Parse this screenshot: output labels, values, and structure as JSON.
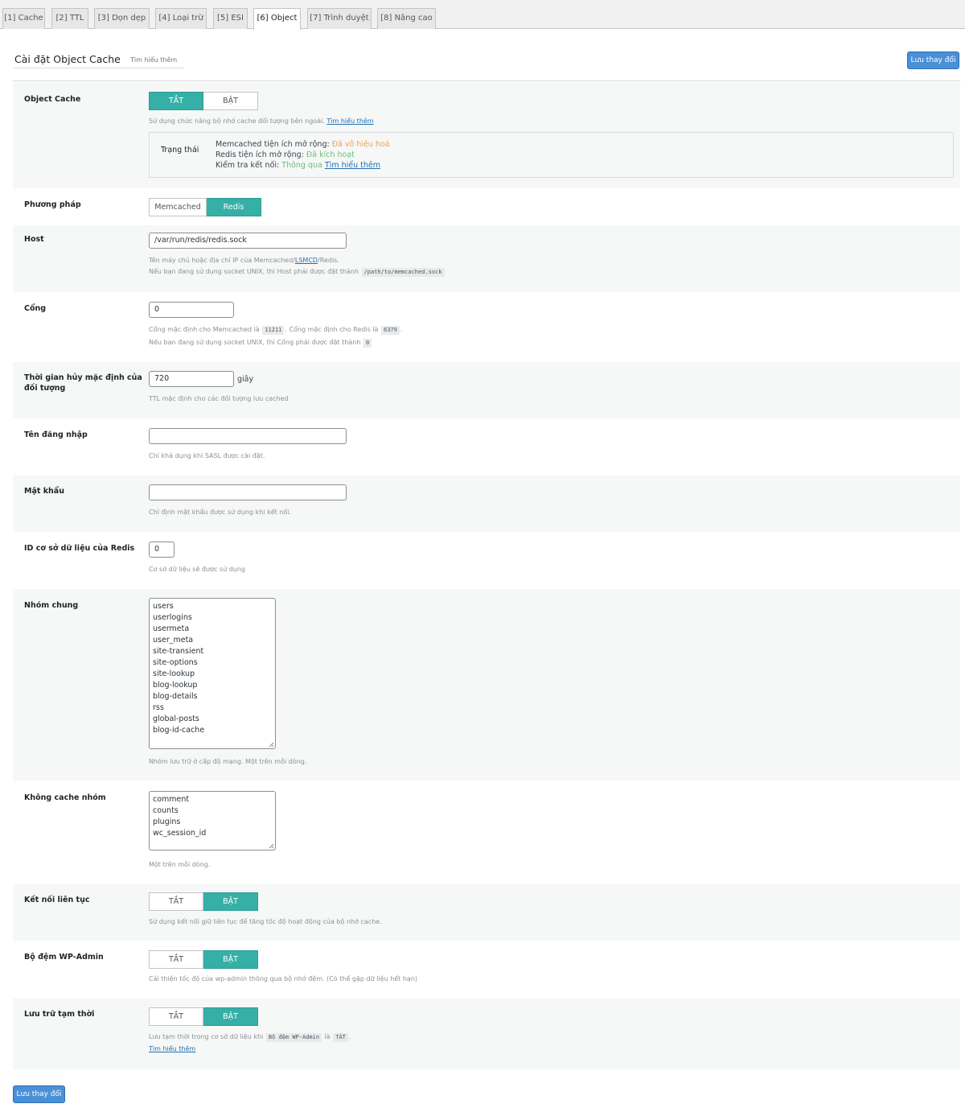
{
  "tabs": [
    "[1] Cache",
    "[2] TTL",
    "[3] Dọn dẹp",
    "[4] Loại trừ",
    "[5] ESI",
    "[6] Object",
    "[7] Trình duyệt",
    "[8] Nâng cao"
  ],
  "active_tab_index": 5,
  "header": {
    "title": "Cài đặt Object Cache",
    "learn_more": "Tìm hiểu thêm"
  },
  "save_label": "Lưu thay đổi",
  "colors": {
    "toggle_on": "#36b0a7",
    "primary_button": "#4a90d9",
    "link": "#2271b1",
    "warning": "#f0a14a",
    "success": "#6cbf77"
  },
  "object_cache": {
    "label": "Object Cache",
    "off": "TẮT",
    "on": "BẬT",
    "selected": "TẮT",
    "desc": "Sử dụng chức năng bộ nhớ cache đối tượng bên ngoài.",
    "desc_link": "Tìm hiểu thêm",
    "status": {
      "label": "Trạng thái",
      "memcached_text": "Memcached tiện ích mở rộng:",
      "memcached_value": "Đã vô hiệu hoá",
      "redis_text": "Redis tiện ích mở rộng:",
      "redis_value": "Đã kích hoạt",
      "conn_text": "Kiểm tra kết nối:",
      "conn_value": "Thông qua",
      "conn_link": "Tìm hiểu thêm"
    }
  },
  "method": {
    "label": "Phương pháp",
    "opt1": "Memcached",
    "opt2": "Redis",
    "selected": "Redis"
  },
  "host": {
    "label": "Host",
    "value": "/var/run/redis/redis.sock",
    "desc1_a": "Tên máy chủ hoặc địa chỉ IP của Memcached/",
    "desc1_link": "LSMCD",
    "desc1_b": "/Redis.",
    "desc2": "Nếu bạn đang sử dụng socket UNIX, thì Host phải được đặt thành",
    "desc2_code": "/path/to/memcached.sock"
  },
  "port": {
    "label": "Cổng",
    "value": "0",
    "desc1_a": "Cổng mặc định cho Memcached là",
    "desc1_code1": "11211",
    "desc1_b": ". Cổng mặc định cho Redis là",
    "desc1_code2": "6379",
    "desc1_c": ".",
    "desc2": "Nếu bạn đang sử dụng socket UNIX, thì Cổng phải được đặt thành",
    "desc2_code": "0"
  },
  "ttl": {
    "label": "Thời gian hủy mặc định của đối tượng",
    "value": "720",
    "unit": "giây",
    "desc": "TTL mặc định cho các đối tượng lưu cached"
  },
  "username": {
    "label": "Tên đăng nhập",
    "value": "",
    "desc": "Chỉ khả dụng khi SASL được cài đặt."
  },
  "password": {
    "label": "Mật khẩu",
    "value": "",
    "desc": "Chỉ định mật khẩu được sử dụng khi kết nối."
  },
  "redis_db": {
    "label": "ID cơ sở dữ liệu của Redis",
    "value": "0",
    "desc": "Cơ sở dữ liệu sẽ được sử dụng"
  },
  "global_groups": {
    "label": "Nhóm chung",
    "items": [
      "users",
      "userlogins",
      "usermeta",
      "user_meta",
      "site-transient",
      "site-options",
      "site-lookup",
      "blog-lookup",
      "blog-details",
      "rss",
      "global-posts",
      "blog-id-cache"
    ],
    "desc": "Nhóm lưu trữ ở cấp độ mạng. Một trên mỗi dòng."
  },
  "no_cache_groups": {
    "label": "Không cache nhóm",
    "items": [
      "comment",
      "counts",
      "plugins",
      "wc_session_id"
    ],
    "desc": "Một trên mỗi dòng."
  },
  "persistent": {
    "label": "Kết nối liên tục",
    "off": "TẮT",
    "on": "BẬT",
    "selected": "BẬT",
    "desc": "Sử dụng kết nối giữ liên tục để tăng tốc độ hoạt động của bộ nhớ cache."
  },
  "wp_admin": {
    "label": "Bộ đệm WP-Admin",
    "off": "TẮT",
    "on": "BẬT",
    "selected": "BẬT",
    "desc": "Cải thiện tốc độ của wp-admin thông qua bộ nhớ đệm. (Có thể gặp dữ liệu hết hạn)"
  },
  "transients": {
    "label": "Lưu trữ tạm thời",
    "off": "TẮT",
    "on": "BẬT",
    "selected": "BẬT",
    "desc_a": "Lưu tạm thời trong cơ sở dữ liệu khi",
    "desc_code1": "Bộ đệm WP-Admin",
    "desc_b": "là",
    "desc_code2": "TẮT",
    "desc_c": ".",
    "desc_link": "Tìm hiểu thêm"
  }
}
